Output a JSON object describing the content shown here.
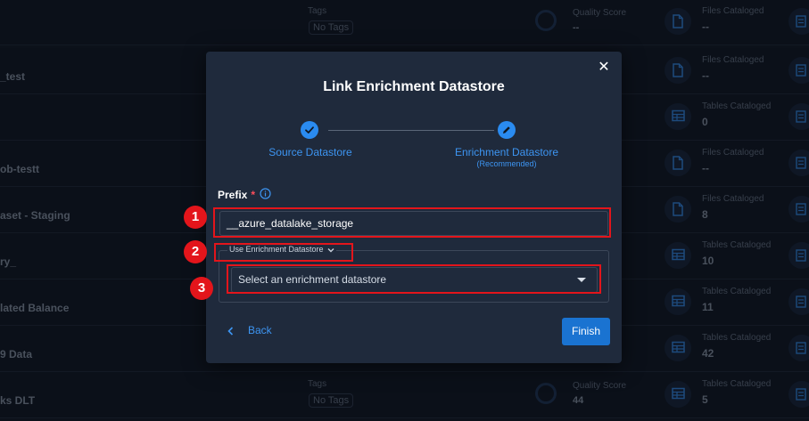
{
  "background": {
    "tags_label": "Tags",
    "no_tags": "No Tags",
    "quality_label": "Quality Score",
    "rows": [
      {
        "name": "",
        "show_tags": true,
        "quality": "--",
        "show_quality": true,
        "catalog_label": "Files Cataloged",
        "catalog_value": "--",
        "icon": "file-icon"
      },
      {
        "name": "_test",
        "show_tags": false,
        "quality": "",
        "show_quality": false,
        "catalog_label": "Files Cataloged",
        "catalog_value": "--",
        "icon": "file-icon"
      },
      {
        "name": "",
        "show_tags": false,
        "quality": "",
        "show_quality": false,
        "catalog_label": "Tables Cataloged",
        "catalog_value": "0",
        "icon": "table-icon"
      },
      {
        "name": "ob-testt",
        "show_tags": false,
        "quality": "",
        "show_quality": false,
        "catalog_label": "Files Cataloged",
        "catalog_value": "--",
        "icon": "file-icon"
      },
      {
        "name": "aset - Staging",
        "show_tags": false,
        "quality": "",
        "show_quality": false,
        "catalog_label": "Files Cataloged",
        "catalog_value": "8",
        "icon": "file-icon"
      },
      {
        "name": "ry_",
        "show_tags": false,
        "quality": "",
        "show_quality": false,
        "catalog_label": "Tables Cataloged",
        "catalog_value": "10",
        "icon": "table-icon"
      },
      {
        "name": "lated Balance",
        "show_tags": false,
        "quality": "",
        "show_quality": false,
        "catalog_label": "Tables Cataloged",
        "catalog_value": "11",
        "icon": "table-icon"
      },
      {
        "name": "9 Data",
        "show_tags": false,
        "quality": "",
        "show_quality": false,
        "catalog_label": "Tables Cataloged",
        "catalog_value": "42",
        "icon": "table-icon"
      },
      {
        "name": "ks DLT",
        "show_tags": true,
        "quality": "44",
        "show_quality": true,
        "catalog_label": "Tables Cataloged",
        "catalog_value": "5",
        "icon": "table-icon"
      }
    ]
  },
  "modal": {
    "title": "Link Enrichment Datastore",
    "close_icon": "close-icon",
    "steps": [
      {
        "label": "Source Datastore",
        "sub": "",
        "icon": "check-icon"
      },
      {
        "label": "Enrichment Datastore",
        "sub": "(Recommended)",
        "icon": "pencil-icon"
      }
    ],
    "prefix_label": "Prefix",
    "prefix_required": "*",
    "prefix_value": "__azure_datalake_storage",
    "use_enrichment_label": "Use Enrichment Datastore",
    "select_placeholder": "Select an enrichment datastore",
    "back_label": "Back",
    "finish_label": "Finish"
  },
  "annotations": [
    "1",
    "2",
    "3"
  ],
  "colors": {
    "accent": "#2a8bf0",
    "highlight": "#e3151b",
    "modal_bg": "#1f2a3c",
    "page_bg": "#0f1722"
  }
}
